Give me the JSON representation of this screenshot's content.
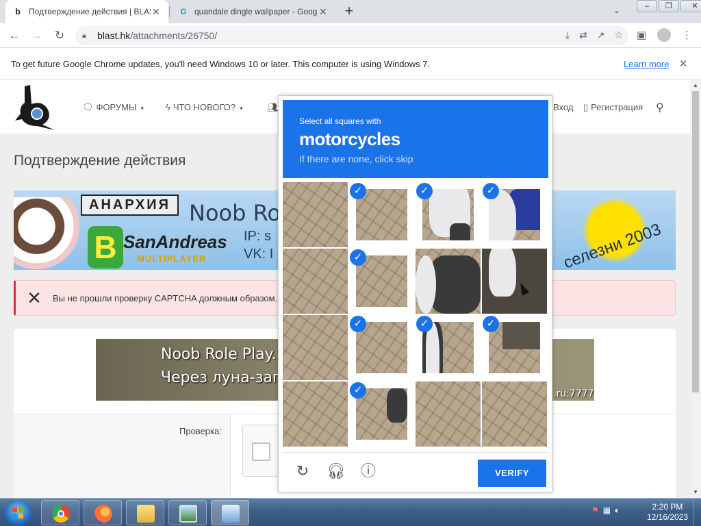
{
  "browser": {
    "tabs": [
      {
        "title": "Подтверждение действия | BLAST",
        "favicon": "blast-logo-icon",
        "active": true
      },
      {
        "title": "quandale dingle wallpaper - Google",
        "favicon": "google-g-icon",
        "active": false
      }
    ],
    "new_tab_label": "+",
    "address": {
      "host": "blast.hk",
      "path": "/attachments/26750/"
    },
    "infobar": {
      "message": "To get future Google Chrome updates, you'll need Windows 10 or later. This computer is using Windows 7.",
      "link": "Learn more"
    }
  },
  "site": {
    "nav": [
      {
        "label": "ФОРУМЫ",
        "icon": "forum-icon"
      },
      {
        "label": "ЧТО НОВОГО?",
        "icon": "bolt-icon"
      }
    ],
    "login": "Вход",
    "register": "Регистрация",
    "page_title": "Подтверждение действия",
    "banner_top": {
      "anarchy": "АНАРХИЯ",
      "noob": "Noob Role",
      "ip": "IP: s",
      "vk": "VK: I",
      "sa": "SanAndreas",
      "mp": "MULTIPLAYER",
      "b": "B",
      "seleznev": "селезни 2003"
    },
    "alert": "Вы не прошли проверку CAPTCHA должным образом. П",
    "banner_mid": {
      "line1": "Noob Role Play. У на",
      "line2": "Через луна-загружат",
      "port": ".ru:7777"
    },
    "field_label": "Проверка:"
  },
  "captcha": {
    "instruction": "Select all squares with",
    "target": "motorcycles",
    "hint": "If there are none, click skip",
    "verify_label": "VERIFY",
    "selected": [
      false,
      true,
      true,
      true,
      false,
      true,
      false,
      false,
      false,
      true,
      true,
      true,
      false,
      true,
      false,
      false
    ]
  },
  "taskbar": {
    "apps": [
      "chrome-icon",
      "firefox-icon",
      "explorer-icon",
      "photo-viewer-icon",
      "control-panel-icon"
    ],
    "time": "2:20 PM",
    "date": "12/16/2023"
  },
  "colors": {
    "accent": "#1a73e8",
    "alert_bg": "#fde4e4",
    "alert_border": "#d0353f"
  }
}
